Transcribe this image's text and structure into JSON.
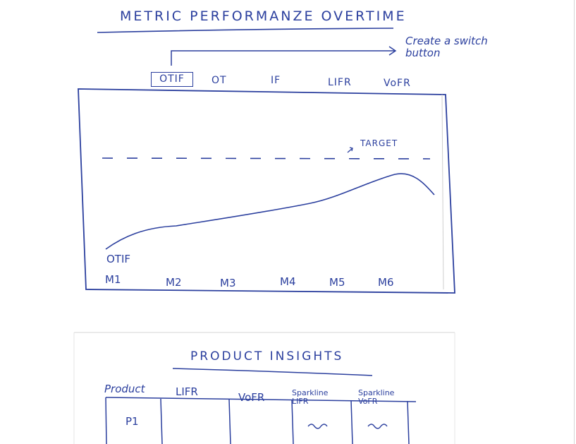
{
  "page_title": "METRIC PERFORMANZE OVERTIME",
  "switch_note": "Create a switch button",
  "tabs": [
    {
      "label": "OTIF",
      "selected": true
    },
    {
      "label": "OT",
      "selected": false
    },
    {
      "label": "IF",
      "selected": false
    },
    {
      "label": "LIFR",
      "selected": false
    },
    {
      "label": "VoFR",
      "selected": false
    }
  ],
  "chart": {
    "target_label": "TARGET",
    "series_label": "OTIF",
    "x_labels": [
      "M1",
      "M2",
      "M3",
      "M4",
      "M5",
      "M6"
    ]
  },
  "insights": {
    "title": "PRODUCT INSIGHTS",
    "columns": [
      "Product",
      "LIFR",
      "VoFR",
      "Sparkline LIFR",
      "Sparkline VoFR"
    ],
    "rows": [
      {
        "product": "P1",
        "lifr": "",
        "vofr": "",
        "spark_lifr": "~",
        "spark_vofr": "~"
      }
    ]
  },
  "colors": {
    "ink": "#2b3f9e",
    "faint_line": "#cfcfcf"
  }
}
